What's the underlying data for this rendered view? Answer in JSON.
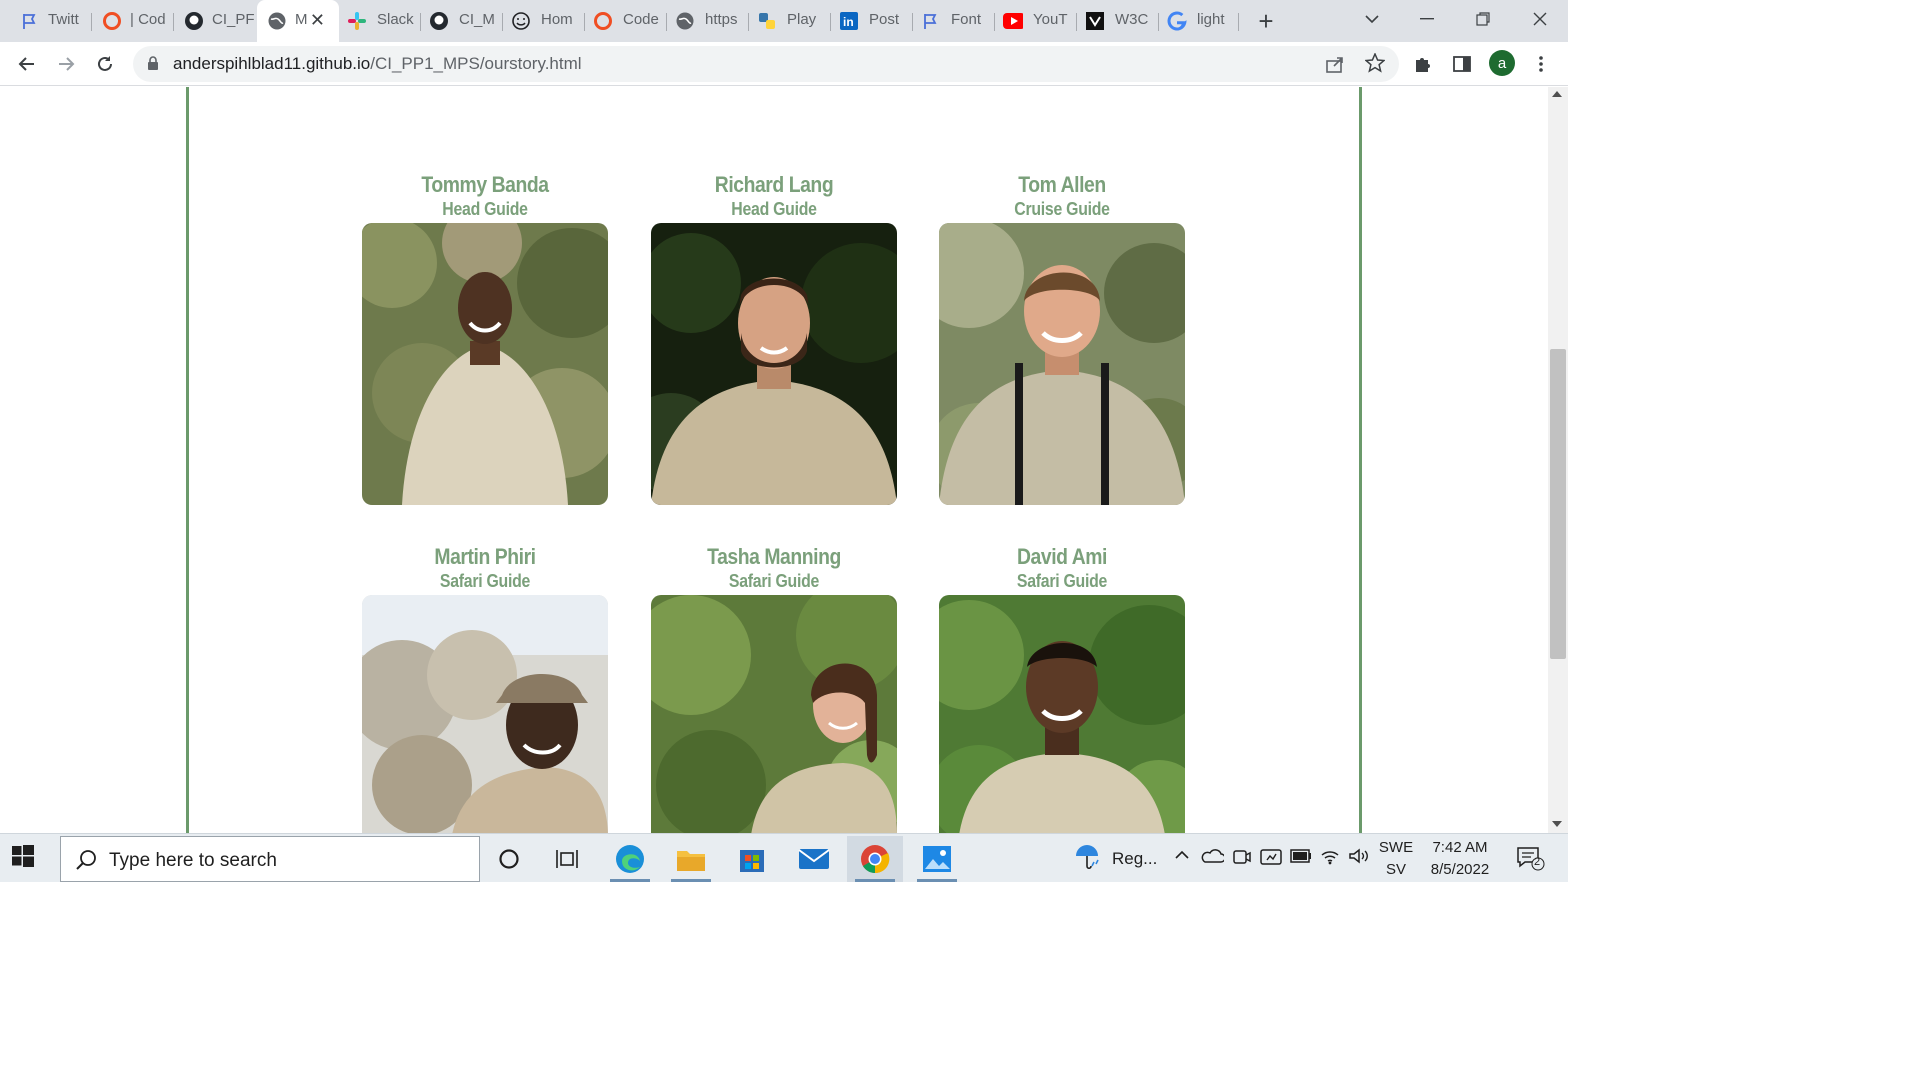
{
  "browser": {
    "tabs": [
      {
        "label": "Twitt",
        "icon": "flag-icon",
        "color": "#4a6fd8"
      },
      {
        "label": "| Cod",
        "icon": "circle-red-icon",
        "color": "#f04e23"
      },
      {
        "label": "CI_PF",
        "icon": "github-icon",
        "color": "#24292f"
      },
      {
        "label": "M",
        "icon": "globe-icon",
        "color": "#5f6368",
        "active": true
      },
      {
        "label": "Slack",
        "icon": "slack-icon",
        "color": "#e01e5a"
      },
      {
        "label": "CI_M",
        "icon": "github-icon",
        "color": "#24292f"
      },
      {
        "label": "Hom",
        "icon": "smiley-icon",
        "color": "#202124"
      },
      {
        "label": "Code",
        "icon": "circle-red-icon",
        "color": "#f04e23"
      },
      {
        "label": "https",
        "icon": "globe-icon",
        "color": "#5f6368"
      },
      {
        "label": "Play",
        "icon": "python-icon",
        "color": "#3776ab"
      },
      {
        "label": "Post",
        "icon": "linkedin-icon",
        "color": "#0a66c2"
      },
      {
        "label": "Font",
        "icon": "flag-icon",
        "color": "#4a6fd8"
      },
      {
        "label": "YouT",
        "icon": "youtube-icon",
        "color": "#ff0000"
      },
      {
        "label": "W3C",
        "icon": "w3c-icon",
        "color": "#111111"
      },
      {
        "label": "light",
        "icon": "google-icon",
        "color": "#4285f4"
      }
    ],
    "url_domain": "anderspihlblad11.github.io",
    "url_path": "/CI_PP1_MPS/ourstory.html",
    "profile_initial": "a"
  },
  "page": {
    "accent_color": "#7ba07b",
    "guides": [
      {
        "name": "Tommy Banda",
        "role": "Head Guide"
      },
      {
        "name": "Richard Lang",
        "role": "Head Guide"
      },
      {
        "name": "Tom Allen",
        "role": "Cruise Guide"
      },
      {
        "name": "Martin Phiri",
        "role": "Safari Guide"
      },
      {
        "name": "Tasha Manning",
        "role": "Safari Guide"
      },
      {
        "name": "David Ami",
        "role": "Safari Guide"
      }
    ]
  },
  "taskbar": {
    "search_placeholder": "Type here to search",
    "weather_label": "Reg...",
    "lang_line1": "SWE",
    "lang_line2": "SV",
    "time": "7:42 AM",
    "date": "8/5/2022",
    "notification_count": "2"
  }
}
